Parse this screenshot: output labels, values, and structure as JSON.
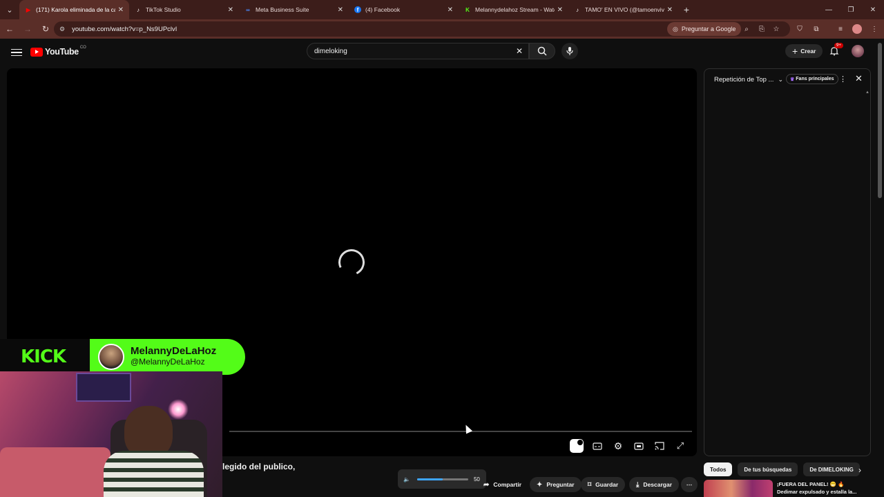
{
  "browser": {
    "tabs": [
      {
        "title": "(171) Karola eliminada de la ca",
        "fav": "▶",
        "color": "#ff0000"
      },
      {
        "title": "TikTok Studio",
        "fav": "♪",
        "color": "#000000"
      },
      {
        "title": "Meta Business Suite",
        "fav": "∞",
        "color": "#1877f2"
      },
      {
        "title": "(4) Facebook",
        "fav": "f",
        "color": "#1877f2"
      },
      {
        "title": "Melannydelahoz Stream - Watc",
        "fav": "K",
        "color": "#53fc18"
      },
      {
        "title": "TAMO' EN VIVO (@tamoenvivo",
        "fav": "♪",
        "color": "#000000"
      }
    ],
    "url": "youtube.com/watch?v=p_Ns9UPclvI",
    "ask_google": "Preguntar a Google"
  },
  "youtube": {
    "logo": "YouTube",
    "country": "CO",
    "search_value": "dimeloking",
    "create_label": "Crear",
    "notif_badge": "9+"
  },
  "overlay": {
    "brand": "KICK",
    "name": "MelannyDeLaHoz",
    "handle": "@MelannyDeLaHoz"
  },
  "panel": {
    "title": "Repetición de Top ...",
    "fans_label": "Fans principales"
  },
  "video": {
    "title_fragment": "legido del publico,",
    "volume": "50",
    "volume_fraction": 0.5
  },
  "actions": {
    "share": "Compartir",
    "ask": "Preguntar",
    "save": "Guardar",
    "download": "Descargar"
  },
  "chips": [
    "Todos",
    "De tus búsquedas",
    "De DIMELOKING"
  ],
  "recommendation": {
    "line1": "¡FUERA DEL PANEL! 😁 🔥",
    "line2": "Dedimar expulsado y estalla la..."
  }
}
